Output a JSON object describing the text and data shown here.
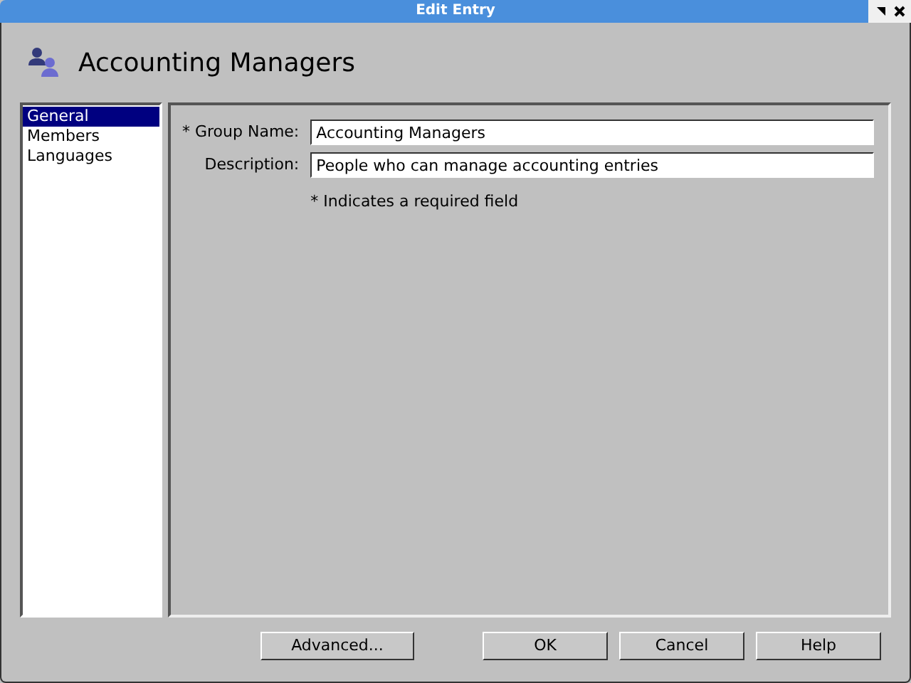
{
  "window": {
    "title": "Edit Entry"
  },
  "header": {
    "title": "Accounting Managers"
  },
  "sidebar": {
    "items": [
      {
        "label": "General",
        "selected": true
      },
      {
        "label": "Members",
        "selected": false
      },
      {
        "label": "Languages",
        "selected": false
      }
    ]
  },
  "form": {
    "fields": [
      {
        "label": "* Group Name:",
        "value": "Accounting Managers"
      },
      {
        "label": "Description:",
        "value": "People who can manage accounting entries"
      }
    ],
    "note": "* Indicates a required field"
  },
  "buttons": [
    {
      "label": "Advanced...",
      "kind": "extra"
    },
    {
      "label": "OK",
      "kind": "main"
    },
    {
      "label": "Cancel",
      "kind": "main"
    },
    {
      "label": "Help",
      "kind": "main"
    }
  ]
}
